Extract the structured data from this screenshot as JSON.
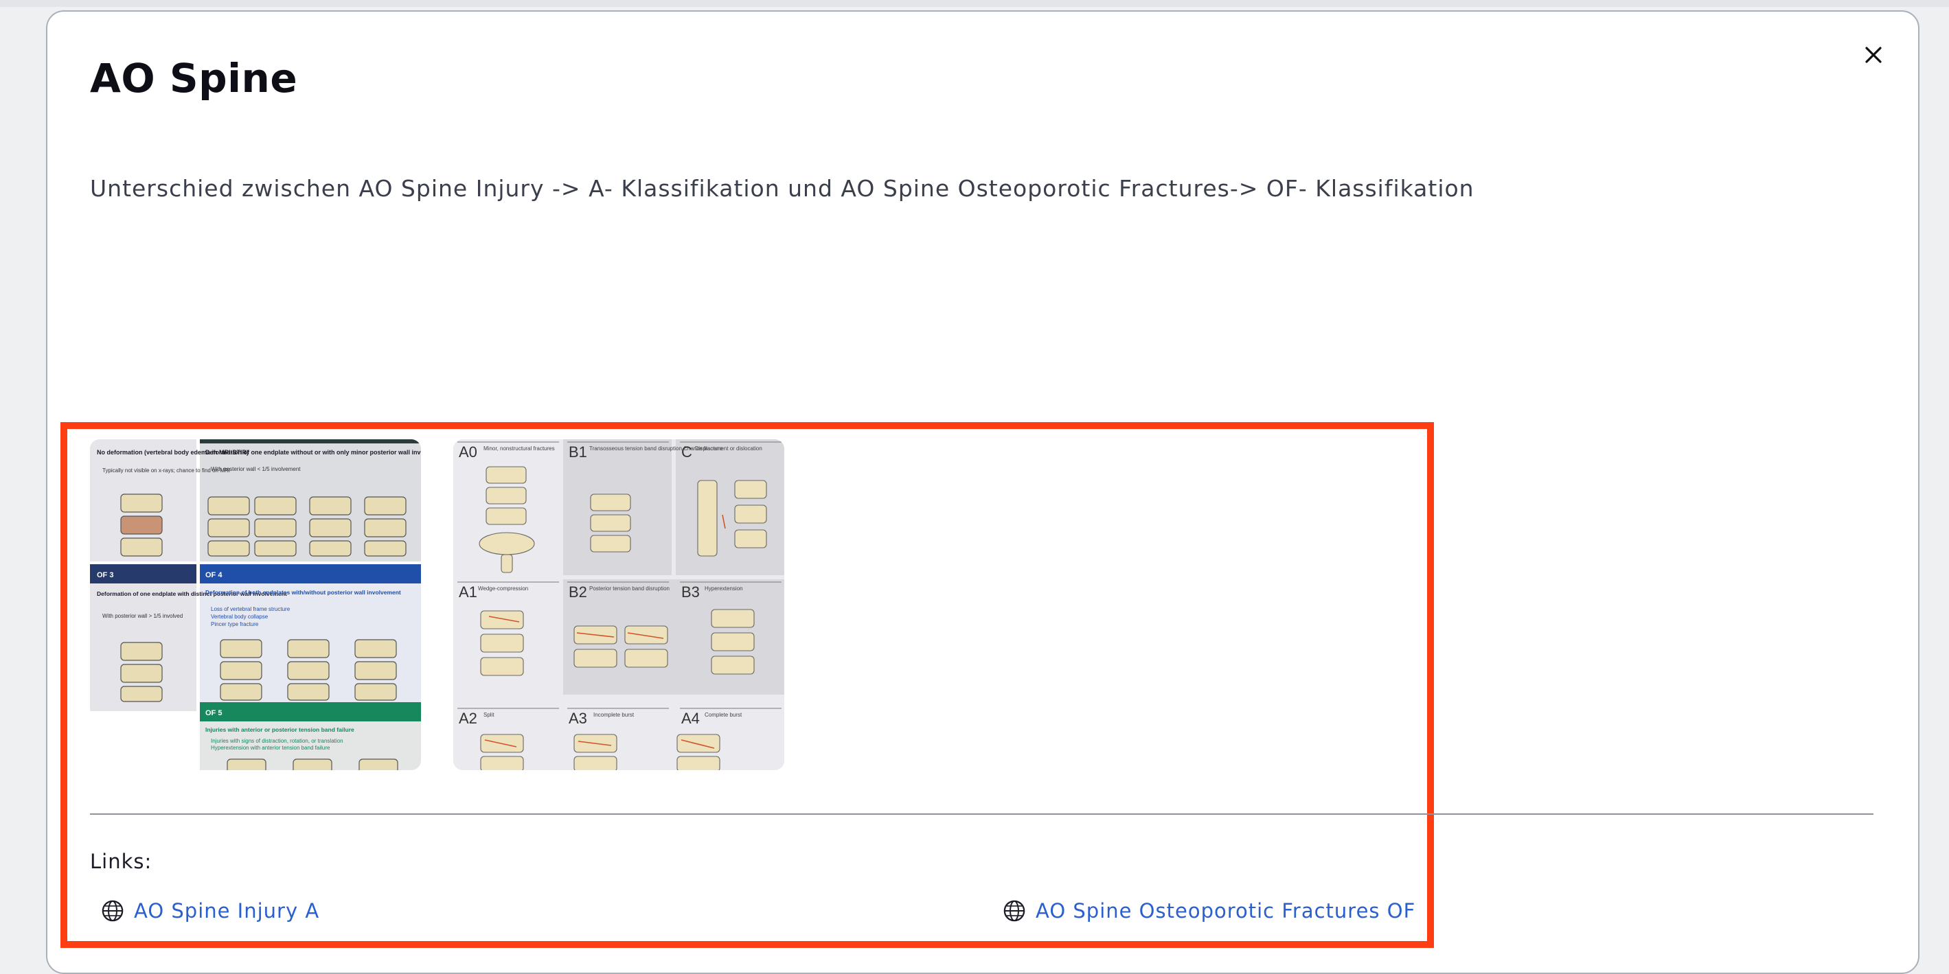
{
  "dialog": {
    "title": "AO Spine",
    "description": "Unterschied zwischen AO Spine Injury -> A- Klassifikation und AO Spine Osteoporotic Fractures-> OF- Klassifikation",
    "close_icon": "close-icon"
  },
  "image_of": {
    "cells": [
      {
        "text": "No deformation (vertebral body edema in MRI-STIR)"
      },
      {
        "text": "Typically not visible on x-rays; chance to find on MRI"
      },
      {
        "text": "Deformation of one endplate without or with only minor posterior wall involvement"
      },
      {
        "text": "With posterior wall < 1/5 involvement"
      },
      {
        "text": "OF 3"
      },
      {
        "text": "Deformation of one endplate with distinct posterior wall involvement"
      },
      {
        "text": "With posterior wall > 1/5 involved"
      },
      {
        "text": "OF 4"
      },
      {
        "text": "Deformation of both endplates with/without posterior wall involvement"
      },
      {
        "text": "Loss of vertebral frame structure"
      },
      {
        "text": "Vertebral body collapse"
      },
      {
        "text": "Pincer type fracture"
      },
      {
        "text": "OF 5"
      },
      {
        "text": "Injuries with anterior or posterior tension band failure"
      },
      {
        "text": "Injuries with signs of distraction, rotation, or translation"
      },
      {
        "text": "Hyperextension with anterior tension band failure"
      }
    ],
    "colors": {
      "navy": "#263a6b",
      "blue": "#1f4fa8",
      "green": "#17875d"
    }
  },
  "image_a": {
    "cells": [
      {
        "code": "A0",
        "desc": "Minor, nonstructural fractures"
      },
      {
        "code": "B1",
        "desc": "Transosseous tension band disruption Chance fracture"
      },
      {
        "code": "C",
        "desc": "Displacement or dislocation"
      },
      {
        "code": "A1",
        "desc": "Wedge-compression"
      },
      {
        "code": "B2",
        "desc": "Posterior tension band disruption"
      },
      {
        "code": "B3",
        "desc": "Hyperextension"
      },
      {
        "code": "A2",
        "desc": "Split"
      },
      {
        "code": "A3",
        "desc": "Incomplete burst"
      },
      {
        "code": "A4",
        "desc": "Complete burst"
      }
    ]
  },
  "links": {
    "label": "Links:",
    "items": [
      {
        "label": "AO Spine Injury A",
        "icon": "globe-icon"
      },
      {
        "label": "AO Spine Osteoporotic Fractures OF",
        "icon": "globe-icon"
      }
    ],
    "color": "#2a5fcf"
  },
  "highlight_color": "#ff3d12"
}
